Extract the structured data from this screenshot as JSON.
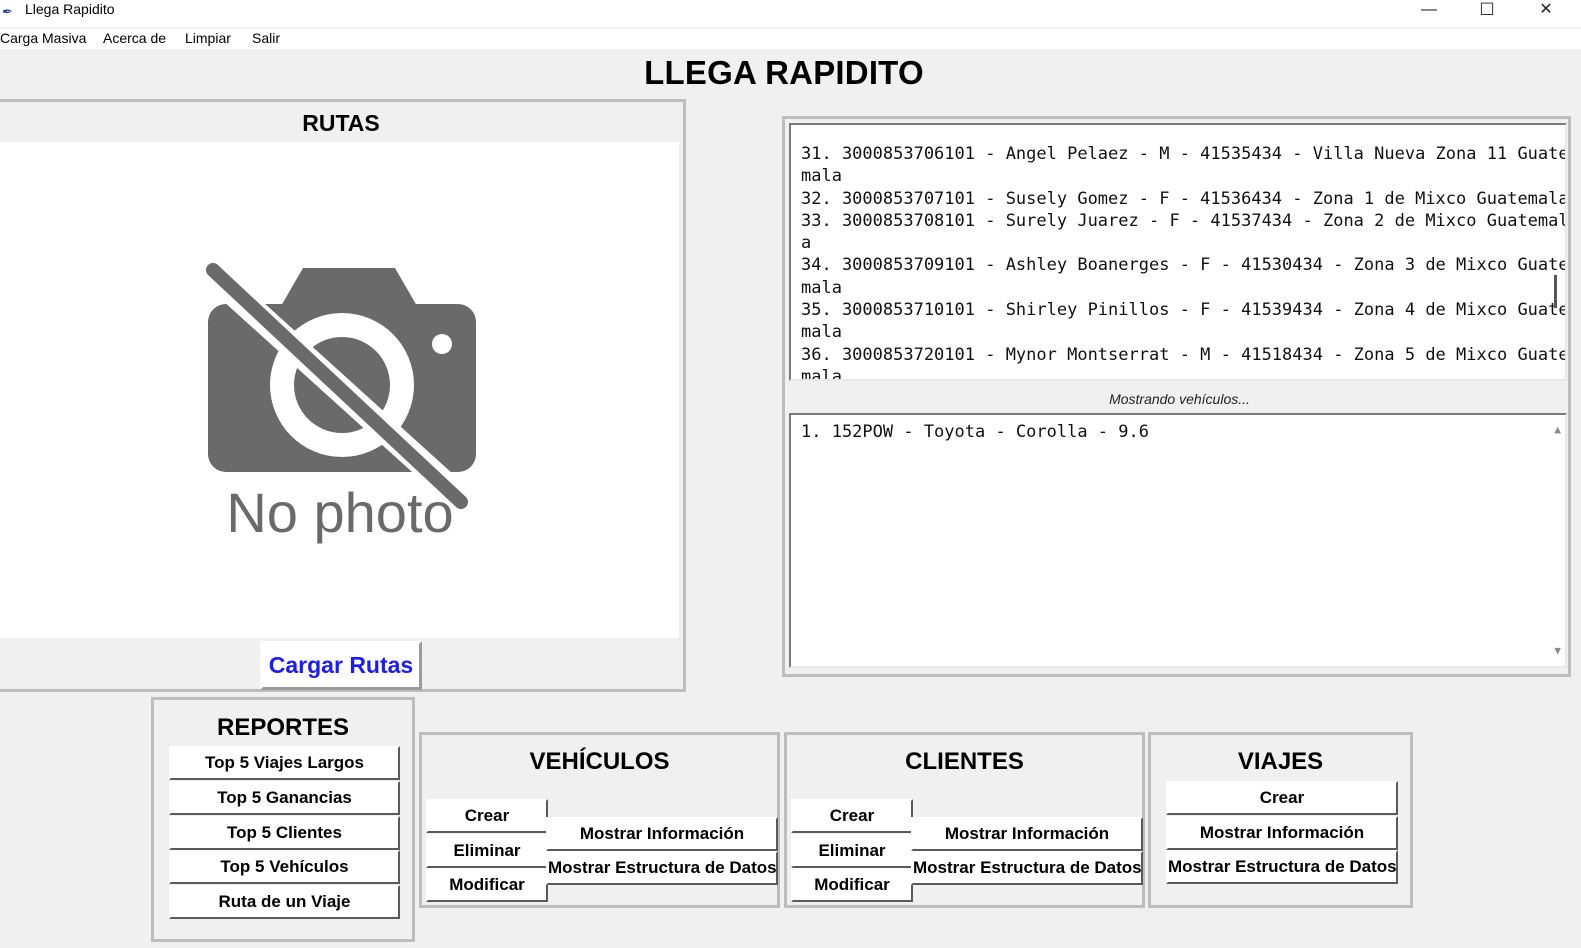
{
  "window": {
    "title": "Llega Rapidito",
    "minimize": "—",
    "maximize": "☐",
    "close": "✕"
  },
  "menu": {
    "items": [
      "Carga Masiva",
      "Acerca de",
      "Limpiar",
      "Salir"
    ]
  },
  "heading": "LLEGA RAPIDITO",
  "rutas": {
    "title": "RUTAS",
    "placeholder_text": "No photo",
    "load_button": "Cargar Rutas"
  },
  "clients_text": [
    "31. 3000853706101 - Angel Pelaez - M - 41535434 - Villa Nueva Zona 11 Guate",
    "mala",
    "32. 3000853707101 - Susely Gomez - F - 41536434 - Zona 1 de Mixco Guatemala",
    "33. 3000853708101 - Surely Juarez - F - 41537434 - Zona 2 de Mixco Guatemal",
    "a",
    "34. 3000853709101 - Ashley Boanerges - F - 41530434 - Zona 3 de Mixco Guate",
    "mala",
    "35. 3000853710101 - Shirley Pinillos - F - 41539434 - Zona 4 de Mixco Guate",
    "mala",
    "36. 3000853720101 - Mynor Montserrat - M - 41518434 - Zona 5 de Mixco Guate",
    "mala"
  ],
  "status": "Mostrando vehículos...",
  "vehicles_text": [
    "1. 152POW - Toyota - Corolla - 9.6"
  ],
  "reportes": {
    "title": "REPORTES",
    "buttons": [
      "Top 5 Viajes Largos",
      "Top 5 Ganancias",
      "Top 5 Clientes",
      "Top 5 Vehículos",
      "Ruta de un Viaje"
    ]
  },
  "vehiculos": {
    "title": "VEHÍCULOS",
    "crear": "Crear",
    "eliminar": "Eliminar",
    "modificar": "Modificar",
    "mostrar_info": "Mostrar Información",
    "mostrar_estructura": "Mostrar Estructura de Datos"
  },
  "clientes": {
    "title": "CLIENTES",
    "crear": "Crear",
    "eliminar": "Eliminar",
    "modificar": "Modificar",
    "mostrar_info": "Mostrar Información",
    "mostrar_estructura": "Mostrar Estructura de Datos"
  },
  "viajes": {
    "title": "VIAJES",
    "crear": "Crear",
    "mostrar_info": "Mostrar Información",
    "mostrar_estructura": "Mostrar Estructura de Datos"
  },
  "colors": {
    "accent_link": "#1a1aff",
    "icon_gray": "#6a6a6a"
  }
}
